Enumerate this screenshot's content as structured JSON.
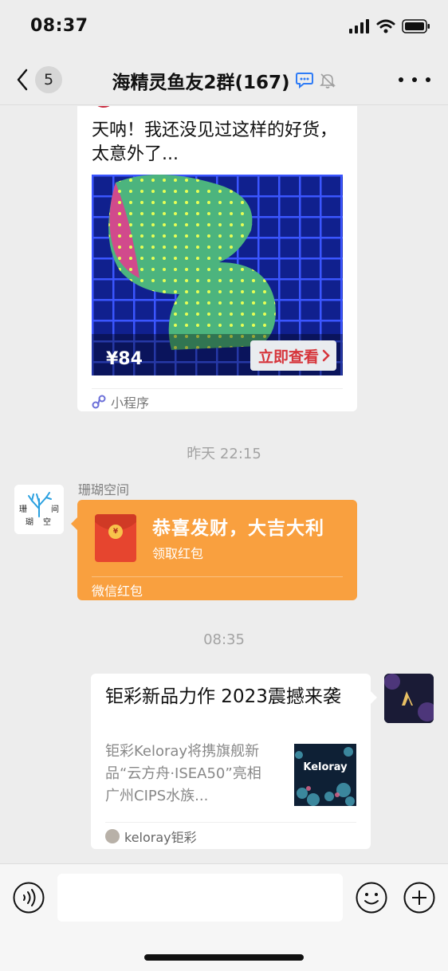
{
  "status_bar": {
    "time": "08:37"
  },
  "nav": {
    "back_count": "5",
    "title": "海精灵鱼友2群(167)",
    "icons": [
      "chat-bubble-icon",
      "mute-bell-icon",
      "more-icon"
    ]
  },
  "messages": {
    "mini_program": {
      "title": "天呐！我还没见过这样的好货，太意外了...",
      "price": "¥84",
      "cta": "立即查看",
      "source": "小程序"
    },
    "timestamp_1": "昨天 22:15",
    "red_packet": {
      "sender": "珊瑚空间",
      "avatar_text": [
        "珊",
        "间",
        "瑚",
        "空"
      ],
      "title": "恭喜发财，大吉大利",
      "subtitle": "领取红包",
      "footer": "微信红包"
    },
    "timestamp_2": "08:35",
    "article": {
      "title": "钜彩新品力作 2023震撼来袭",
      "description": "钜彩Keloray将携旗舰新品“云方舟·ISEA50”亮相广州CIPS水族...",
      "thumb_text": "Keloray",
      "source": "keloray钜彩"
    }
  },
  "input_bar": {
    "icons": [
      "voice-icon",
      "emoji-icon",
      "plus-icon"
    ]
  },
  "colors": {
    "background": "#ededed",
    "red_packet": "#f9a03f",
    "cta_text": "#d6343a"
  }
}
